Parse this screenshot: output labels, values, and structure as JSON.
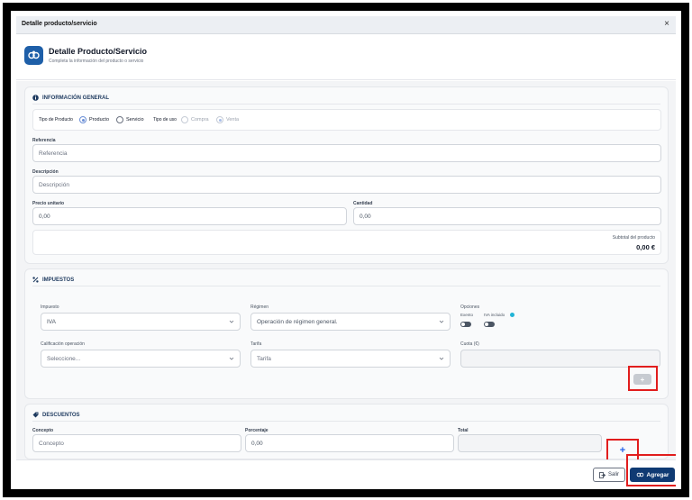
{
  "window": {
    "title": "Detalle producto/servicio",
    "close": "×"
  },
  "header": {
    "heading": "Detalle Producto/Servicio",
    "subtitle": "Completa la información del producto o servicio"
  },
  "general": {
    "section_title": "INFORMACIÓN GENERAL",
    "product_type_label": "Tipo de Producto",
    "product_type_options": [
      {
        "label": "Producto",
        "selected": true
      },
      {
        "label": "Servicio",
        "selected": false
      }
    ],
    "use_type_label": "Tipo de uso",
    "use_type_options": [
      {
        "label": "Compra",
        "selected": false,
        "disabled": true
      },
      {
        "label": "Venta",
        "selected": true,
        "disabled": true
      }
    ],
    "reference_label": "Referencia",
    "reference_placeholder": "Referencia",
    "description_label": "Descripción",
    "description_placeholder": "Descripción",
    "unit_price_label": "Precio unitario",
    "unit_price_value": "0,00",
    "quantity_label": "Cantidad",
    "quantity_value": "0,00",
    "subtotal_label": "Subtotal del producto",
    "subtotal_value": "0,00 €"
  },
  "taxes": {
    "section_title": "IMPUESTOS",
    "tax_label": "Impuesto",
    "tax_value": "IVA",
    "regime_label": "Régimen",
    "regime_value": "Operación de régimen general.",
    "options_label": "Opciones",
    "exempt_label": "Exento",
    "vat_included_label": "IVA incluido",
    "exempt_on": false,
    "vat_included_on": false,
    "qualification_label": "Calificación operación",
    "qualification_placeholder": "Seleccione...",
    "rate_label": "Tarifa",
    "rate_placeholder": "Tarifa",
    "quota_label": "Cuota (€)",
    "quota_value": "",
    "add_label": "+"
  },
  "discounts": {
    "section_title": "DESCUENTOS",
    "concept_label": "Concepto",
    "concept_placeholder": "Concepto",
    "percentage_label": "Porcentaje",
    "percentage_value": "0,00",
    "total_label": "Total",
    "total_value": "",
    "add_label": "+"
  },
  "footer": {
    "exit_label": "Salir",
    "add_label": "Agregar"
  },
  "colors": {
    "brand": "#1e5fa8",
    "primary_button": "#0f3a73",
    "highlight": "#e11d1d",
    "accent_plus": "#2563eb"
  }
}
